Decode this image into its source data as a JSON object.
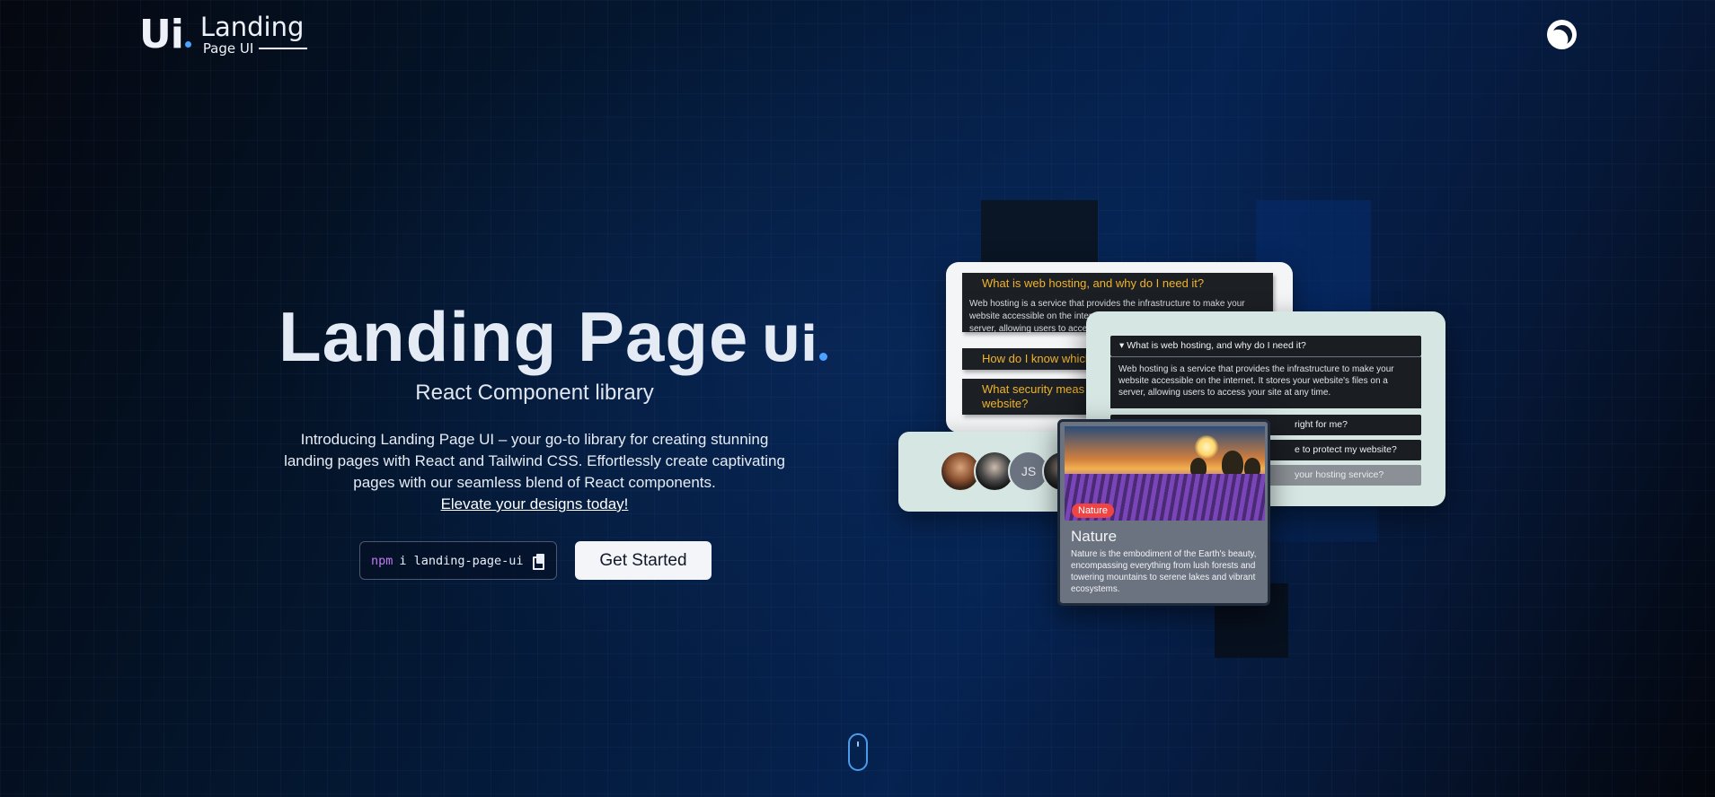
{
  "header": {
    "logo_mark": "Ui",
    "logo_title": "Landing",
    "logo_sub": "Page UI",
    "theme_toggle_icon": "moon-icon"
  },
  "hero": {
    "title": "Landing Page",
    "title_mark": "Ui",
    "subtitle": "React Component library",
    "description": "Introducing Landing Page UI – your go-to library for creating stunning landing pages with React and Tailwind CSS. Effortlessly create captivating pages with our seamless blend of React components.",
    "link": "Elevate your designs today!",
    "npm_keyword": "npm",
    "npm_command": "i landing-page-ui",
    "cta": "Get Started"
  },
  "preview": {
    "faq_back": {
      "q1": "What is web hosting, and why do I need it?",
      "a1": "Web hosting is a service that provides the infrastructure to make your website accessible on the internet. It stores your website's files on a server, allowing users to access your site at any time.",
      "q2": "How do I know which",
      "q3": "What security meas",
      "q3b": "website?"
    },
    "faq_front": {
      "q1": "What is web hosting, and why do I need it?",
      "a1": "Web hosting is a service that provides the infrastructure to make your website accessible on the internet. It stores your website's files on a server, allowing users to access your site at any time.",
      "q2": "right for me?",
      "q3": "e to protect my website?",
      "q4": "your hosting service?"
    },
    "avatars": {
      "initials": "JS"
    },
    "nature_card": {
      "tag": "Nature",
      "title": "Nature",
      "text": "Nature is the embodiment of the Earth's beauty, encompassing everything from lush forests and towering mountains to serene lakes and vibrant ecosystems."
    }
  },
  "colors": {
    "accent": "#4aa3ff",
    "faq_question": "#f0b429",
    "tag": "#ef4444",
    "npm_keyword": "#c07cf2"
  }
}
